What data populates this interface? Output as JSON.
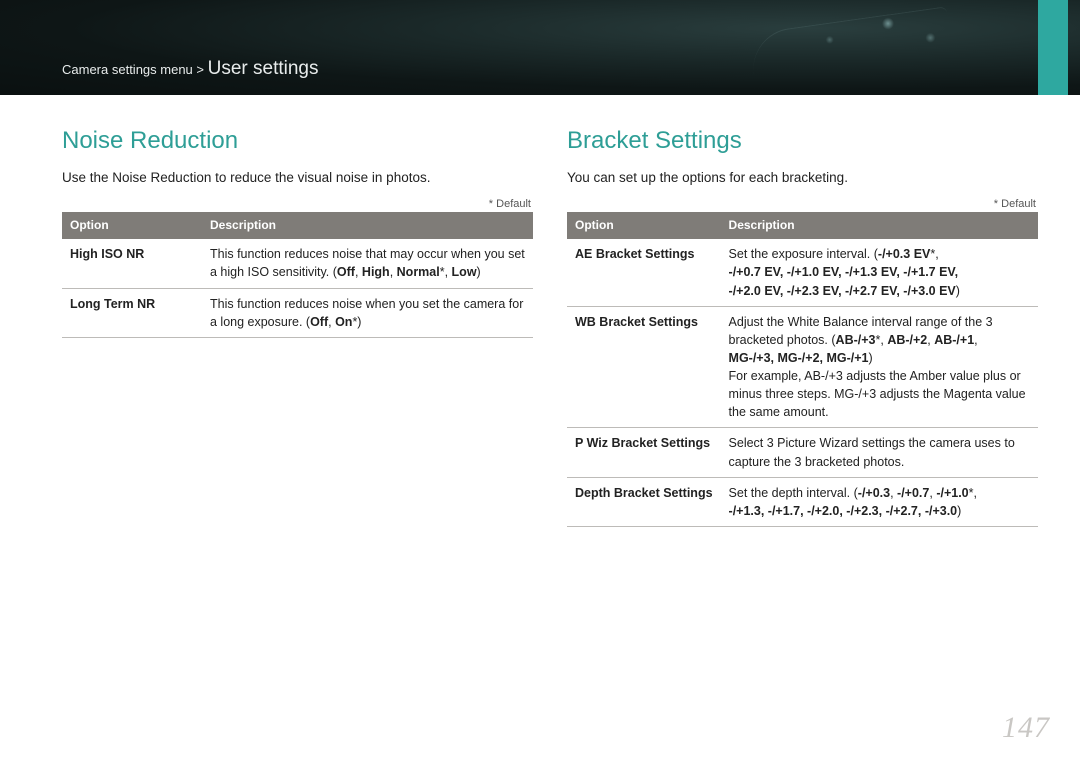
{
  "breadcrumb": {
    "parent": "Camera settings menu >",
    "current": "User settings"
  },
  "page_number": "147",
  "left": {
    "title": "Noise Reduction",
    "intro": "Use the Noise Reduction to reduce the visual noise in photos.",
    "default_note": "* Default",
    "th_option": "Option",
    "th_desc": "Description",
    "rows": [
      {
        "name": "High ISO NR",
        "desc_a": "This function reduces noise that may occur when you set a high ISO sensitivity. (",
        "desc_b": "Off",
        "desc_c": ", ",
        "desc_d": "High",
        "desc_e": ", ",
        "desc_f": "Normal",
        "desc_g": "*, ",
        "desc_h": "Low",
        "desc_i": ")"
      },
      {
        "name": "Long Term NR",
        "desc_a": "This function reduces noise when you set the camera for a long exposure. (",
        "desc_b": "Off",
        "desc_c": ", ",
        "desc_d": "On",
        "desc_e": "*)"
      }
    ]
  },
  "right": {
    "title": "Bracket Settings",
    "intro": "You can set up the options for each bracketing.",
    "default_note": "* Default",
    "th_option": "Option",
    "th_desc": "Description",
    "rows": [
      {
        "name": "AE Bracket Settings",
        "p1": "Set the exposure interval. (",
        "b1": "-/+0.3 EV",
        "p2": "*,",
        "line2": "-/+0.7 EV, -/+1.0 EV, -/+1.3 EV, -/+1.7 EV,",
        "line3": "-/+2.0 EV, -/+2.3 EV, -/+2.7 EV, -/+3.0 EV",
        "p3": ")"
      },
      {
        "name": "WB Bracket Settings",
        "p1": "Adjust the White Balance interval range of the 3 bracketed photos. (",
        "b1": "AB-/+3",
        "p2": "*, ",
        "b2": "AB-/+2",
        "p3": ", ",
        "b3": "AB-/+1",
        "p4": ",",
        "line2": "MG-/+3, MG-/+2, MG-/+1",
        "p5": ")",
        "tail": "For example, AB-/+3 adjusts the Amber value plus or minus three steps. MG-/+3 adjusts the Magenta value the same amount."
      },
      {
        "name": "P Wiz Bracket Settings",
        "p1": "Select 3 Picture Wizard settings the camera uses to capture the 3 bracketed photos."
      },
      {
        "name": "Depth Bracket Settings",
        "p1": "Set the depth interval. (",
        "b1": "-/+0.3",
        "p2": ", ",
        "b2": "-/+0.7",
        "p3": ", ",
        "b3": "-/+1.0",
        "p4": "*,",
        "line2": "-/+1.3, -/+1.7, -/+2.0, -/+2.3, -/+2.7, -/+3.0",
        "p5": ")"
      }
    ]
  }
}
